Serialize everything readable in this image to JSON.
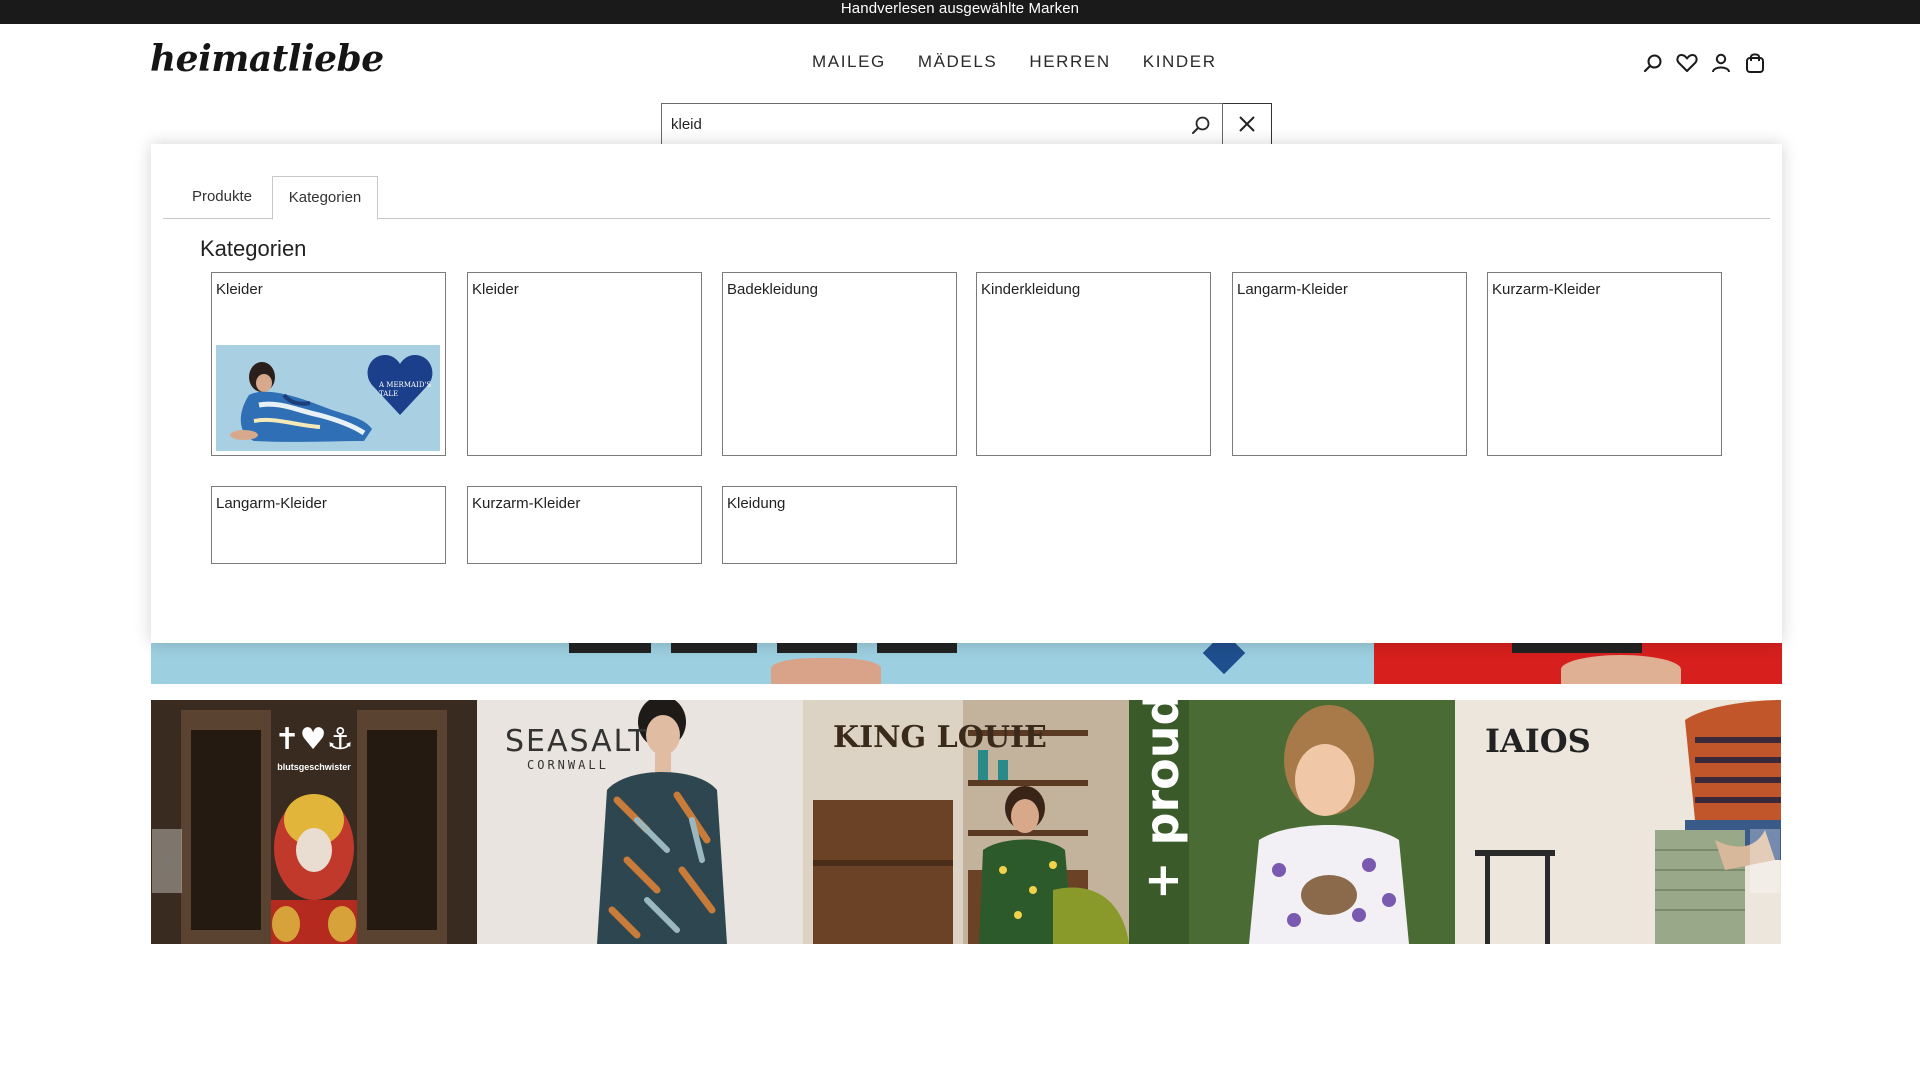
{
  "announcement": "Handverlesen ausgewählte Marken",
  "logo": "heimatliebe",
  "nav": [
    "MAILEG",
    "MÄDELS",
    "HERREN",
    "KINDER"
  ],
  "header_icons": [
    "search-icon",
    "heart-icon",
    "user-icon",
    "bag-icon"
  ],
  "search": {
    "value": "kleid",
    "placeholder": ""
  },
  "dropdown": {
    "tabs": [
      {
        "label": "Produkte",
        "active": false
      },
      {
        "label": "Kategorien",
        "active": true
      }
    ],
    "section_title": "Kategorien",
    "categories": [
      {
        "label": "Kleider",
        "image_text": "A MERMAID'S TALE"
      },
      {
        "label": "Kleider"
      },
      {
        "label": "Badekleidung"
      },
      {
        "label": "Kinderkleidung"
      },
      {
        "label": "Langarm-Kleider"
      },
      {
        "label": "Kurzarm-Kleider"
      },
      {
        "label": "Langarm-Kleider"
      },
      {
        "label": "Kurzarm-Kleider"
      },
      {
        "label": "Kleidung"
      }
    ]
  },
  "brands": [
    {
      "name": "blutsgeschwister",
      "logo_symbols": "✝♥⚓"
    },
    {
      "name": "SEASALT",
      "sub": "CORNWALL"
    },
    {
      "name": "KING LOUIE"
    },
    {
      "name": "+ proud"
    },
    {
      "name": "IAIOS"
    }
  ],
  "colors": {
    "topbar": "#1a1a1a",
    "hero_blue": "#9ccfe0",
    "hero_red": "#d7201e"
  }
}
